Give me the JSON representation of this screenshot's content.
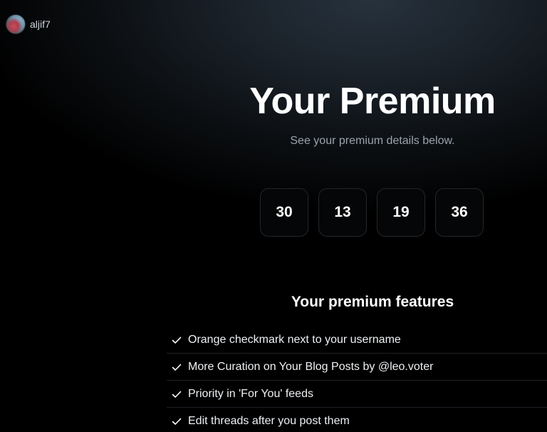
{
  "user": {
    "name": "aljif7"
  },
  "hero": {
    "title": "Your Premium",
    "subtitle": "See your premium details below."
  },
  "countdown": [
    "30",
    "13",
    "19",
    "36"
  ],
  "features": {
    "heading": "Your premium features",
    "items": [
      "Orange checkmark next to your username",
      "More Curation on Your Blog Posts by @leo.voter",
      "Priority in 'For You' feeds",
      "Edit threads after you post them"
    ],
    "icon": "check-icon"
  }
}
